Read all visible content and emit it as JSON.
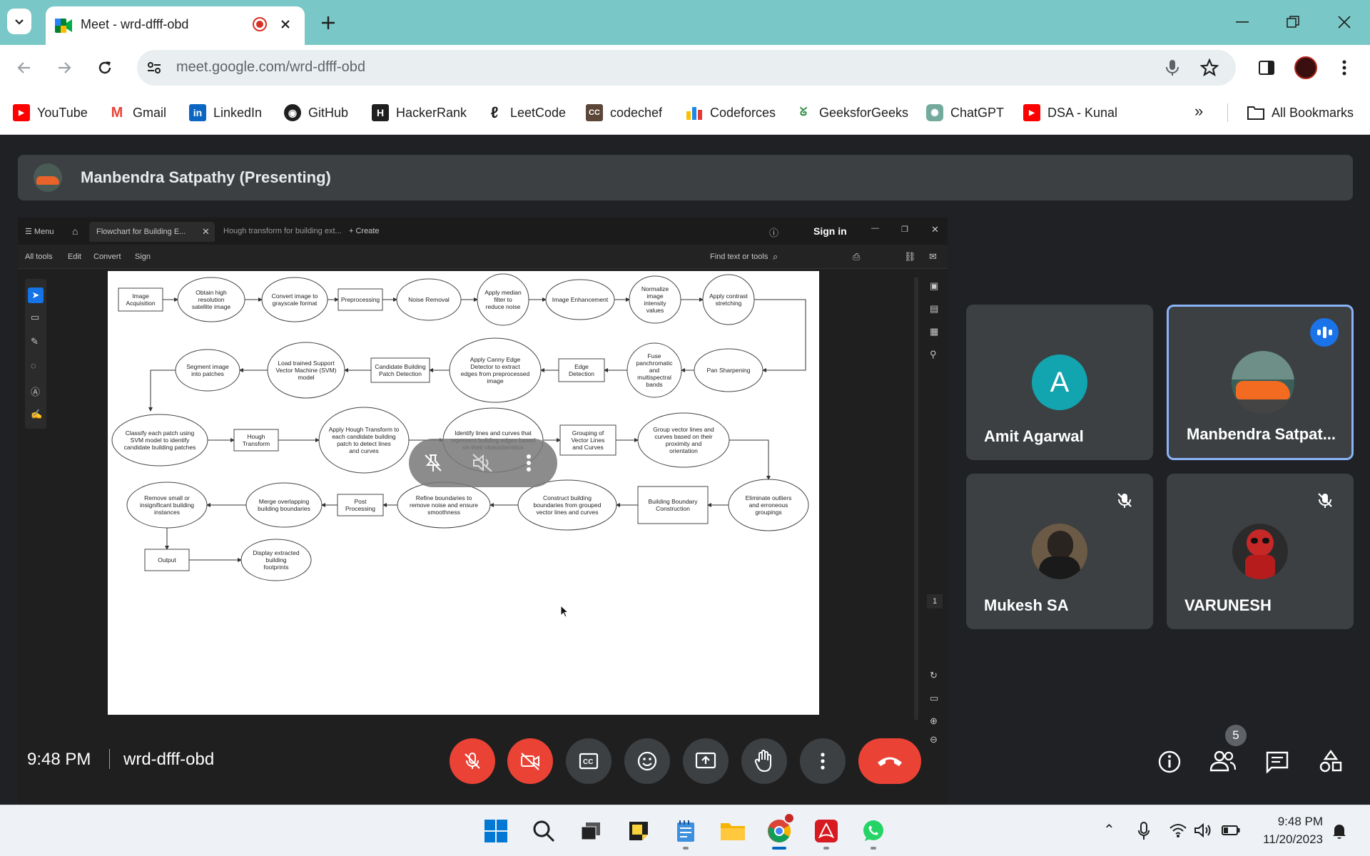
{
  "browser": {
    "tab_title": "Meet - wrd-dfff-obd",
    "url": "meet.google.com/wrd-dfff-obd",
    "bookmarks": [
      {
        "label": "YouTube"
      },
      {
        "label": "Gmail"
      },
      {
        "label": "LinkedIn"
      },
      {
        "label": "GitHub"
      },
      {
        "label": "HackerRank"
      },
      {
        "label": "LeetCode"
      },
      {
        "label": "codechef"
      },
      {
        "label": "Codeforces"
      },
      {
        "label": "GeeksforGeeks"
      },
      {
        "label": "ChatGPT"
      },
      {
        "label": "DSA - Kunal"
      }
    ],
    "all_bookmarks": "All Bookmarks"
  },
  "meet": {
    "presenter_label": "Manbendra Satpathy (Presenting)",
    "time": "9:48 PM",
    "meeting_code": "wrd-dfff-obd",
    "participant_count": "5",
    "participants": [
      {
        "name": "Amit Agarwal",
        "initial": "A"
      },
      {
        "name": "Manbendra Satpat..."
      },
      {
        "name": "Mukesh SA"
      },
      {
        "name": "VARUNESH"
      }
    ]
  },
  "acrobat": {
    "menu": "Menu",
    "tab1": "Flowchart for Building E...",
    "tab2": "Hough transform for building ext...",
    "create": "Create",
    "sign_in": "Sign in",
    "tools": [
      "All tools",
      "Edit",
      "Convert",
      "Sign"
    ],
    "find": "Find text or tools",
    "page_number": "1"
  },
  "flowchart": {
    "nodes": [
      "Image Acquisition",
      "Obtain high resolution satellite image",
      "Convert image to grayscale format",
      "Preprocessing",
      "Noise Removal",
      "Apply median filter to reduce noise",
      "Image Enhancement",
      "Normalize image intensity values",
      "Apply contrast stretching",
      "Pan Sharpening",
      "Fuse panchromatic and multispectral bands",
      "Edge Detection",
      "Apply Canny Edge Detector to extract edges from preprocessed image",
      "Candidate Building Patch Detection",
      "Load trained Support Vector Machine (SVM) model",
      "Segment image into patches",
      "Classify each patch using SVM model to identify candidate building patches",
      "Hough Transform",
      "Apply Hough Transform to each candidate building patch to detect lines and curves",
      "Identify lines and curves that represent building edges based on their characteristics",
      "Grouping of Vector Lines and Curves",
      "Group vector lines and curves based on their proximity and orientation",
      "Eliminate outliers and erroneous groupings",
      "Building Boundary Construction",
      "Construct building boundaries from grouped vector lines and curves",
      "Refine boundaries to remove noise and ensure smoothness",
      "Post Processing",
      "Merge overlapping building boundaries",
      "Remove small or insignificant building instances",
      "Output",
      "Display extracted building footprints"
    ]
  },
  "taskbar": {
    "time": "9:48 PM",
    "date": "11/20/2023"
  },
  "colors": {
    "tabstrip": "#79c7c6",
    "meet_bg": "#202124",
    "tile": "#3c4043",
    "red": "#ea4335",
    "accent_blue": "#1a73e8",
    "avatar_teal": "#12a4af"
  }
}
